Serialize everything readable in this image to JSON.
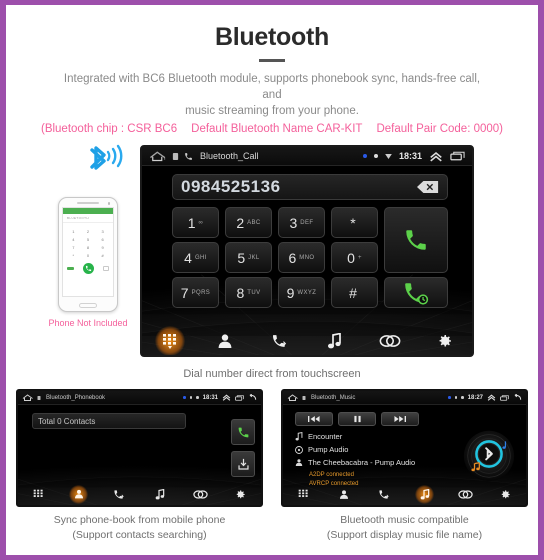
{
  "header": {
    "title": "Bluetooth",
    "subtitle_line1": "Integrated with BC6 Bluetooth module, supports phonebook sync, hands-free call, and",
    "subtitle_line2": "music streaming from your phone.",
    "highlight": {
      "chip": "(Bluetooth chip : CSR BC6",
      "name": "Default Bluetooth Name CAR-KIT",
      "pair": "Default Pair Code: 0000)"
    },
    "accent_color": "#f4609b",
    "border_color": "#9d4fab"
  },
  "phone_mock": {
    "caption": "Phone Not Included",
    "app_label": "BLUETOOTH",
    "keys": [
      "1",
      "2",
      "3",
      "4",
      "5",
      "6",
      "7",
      "8",
      "9",
      "*",
      "0",
      "#"
    ],
    "bluetooth_icon": "bluetooth-signal-icon"
  },
  "dial_screen": {
    "status_bar": {
      "app_title": "Bluetooth_Call",
      "time": "18:31",
      "home_icon": "home-icon",
      "sd_icon": "sd-card-icon",
      "call_icon": "call-icon",
      "expand_icon": "chevron-up-icon",
      "recent_icon": "recent-apps-icon",
      "back_icon": "back-arrow-icon"
    },
    "number_field": {
      "value": "0984525136",
      "backspace_icon": "backspace-icon"
    },
    "keys": [
      {
        "digit": "1",
        "letters": "∞"
      },
      {
        "digit": "2",
        "letters": "ABC"
      },
      {
        "digit": "3",
        "letters": "DEF"
      },
      {
        "digit": "*",
        "letters": ""
      },
      {
        "digit": "4",
        "letters": "GHI"
      },
      {
        "digit": "5",
        "letters": "JKL"
      },
      {
        "digit": "6",
        "letters": "MNO"
      },
      {
        "digit": "0",
        "letters": "+"
      },
      {
        "digit": "7",
        "letters": "PQRS"
      },
      {
        "digit": "8",
        "letters": "TUV"
      },
      {
        "digit": "9",
        "letters": "WXYZ"
      },
      {
        "digit": "#",
        "letters": ""
      }
    ],
    "call_button_icon": "call-answer-icon",
    "redial_button_icon": "call-redial-icon",
    "nav": [
      {
        "name": "dialpad",
        "icon": "dialpad-icon",
        "active": true
      },
      {
        "name": "contacts",
        "icon": "contact-person-icon",
        "active": false
      },
      {
        "name": "call-history",
        "icon": "call-history-icon",
        "active": false
      },
      {
        "name": "music",
        "icon": "music-note-icon",
        "active": false
      },
      {
        "name": "pair",
        "icon": "link-rings-icon",
        "active": false
      },
      {
        "name": "settings",
        "icon": "gear-icon",
        "active": false
      }
    ],
    "caption": "Dial number direct from touchscreen"
  },
  "phonebook_screen": {
    "status_bar": {
      "app_title": "Bluetooth_Phonebook",
      "time": "18:31"
    },
    "search_value": "Total 0 Contacts",
    "call_button_icon": "call-answer-icon",
    "download_button_icon": "download-contacts-icon",
    "nav": [
      {
        "name": "dialpad",
        "icon": "dialpad-icon",
        "active": false
      },
      {
        "name": "contacts",
        "icon": "contact-person-icon",
        "active": true
      },
      {
        "name": "call-history",
        "icon": "call-history-icon",
        "active": false
      },
      {
        "name": "music",
        "icon": "music-note-icon",
        "active": false
      },
      {
        "name": "pair",
        "icon": "link-rings-icon",
        "active": false
      },
      {
        "name": "settings",
        "icon": "gear-icon",
        "active": false
      }
    ],
    "caption_line1": "Sync phone-book from mobile phone",
    "caption_line2": "(Support contacts searching)"
  },
  "music_screen": {
    "status_bar": {
      "app_title": "Bluetooth_Music",
      "time": "18:27"
    },
    "transport": [
      {
        "name": "previous",
        "icon": "skip-previous-icon"
      },
      {
        "name": "pause",
        "icon": "pause-icon"
      },
      {
        "name": "next",
        "icon": "skip-next-icon"
      }
    ],
    "track_title": "Encounter",
    "album": "Pump Audio",
    "artist": "The Cheebacabra - Pump Audio",
    "a2dp_status": "A2DP connected",
    "avrcp_status": "AVRCP connected",
    "disc_icon": "bluetooth-disc-icon",
    "nav": [
      {
        "name": "dialpad",
        "icon": "dialpad-icon",
        "active": false
      },
      {
        "name": "contacts",
        "icon": "contact-person-icon",
        "active": false
      },
      {
        "name": "call-history",
        "icon": "call-history-icon",
        "active": false
      },
      {
        "name": "music",
        "icon": "music-note-icon",
        "active": true
      },
      {
        "name": "pair",
        "icon": "link-rings-icon",
        "active": false
      },
      {
        "name": "settings",
        "icon": "gear-icon",
        "active": false
      }
    ],
    "caption_line1": "Bluetooth music compatible",
    "caption_line2": "(Support display music file name)"
  }
}
